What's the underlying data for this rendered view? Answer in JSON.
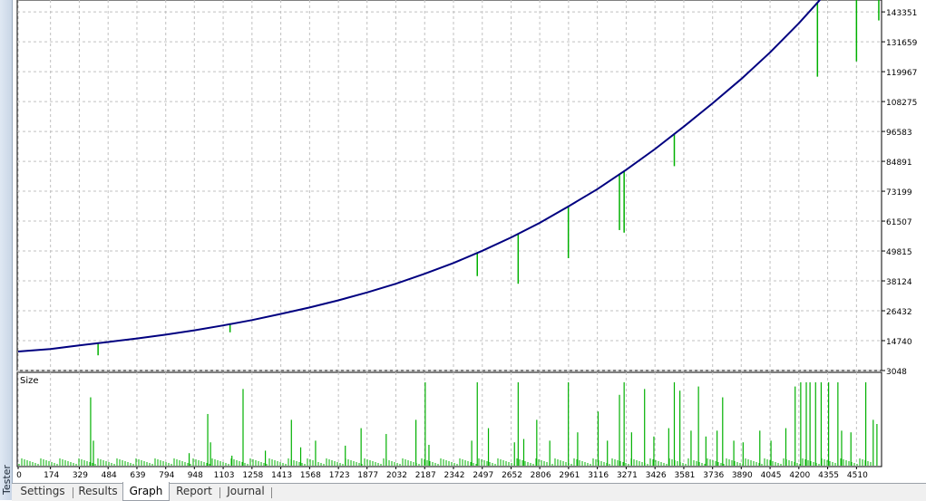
{
  "panel": {
    "title": "Tester"
  },
  "tabs": [
    {
      "label": "Settings",
      "active": false
    },
    {
      "label": "Results",
      "active": false
    },
    {
      "label": "Graph",
      "active": true
    },
    {
      "label": "Report",
      "active": false
    },
    {
      "label": "Journal",
      "active": false
    }
  ],
  "colors": {
    "balance": "#000080",
    "equity": "#00b000",
    "size_bars": "#00b000",
    "grid": "#c0c0c0",
    "background": "#ffffff"
  },
  "chart_data": [
    {
      "type": "line",
      "y_ticks": [
        "3048",
        "14740",
        "26432",
        "38124",
        "49815",
        "61507",
        "73199",
        "84891",
        "96583",
        "108275",
        "119967",
        "131659",
        "143351"
      ],
      "ylim": [
        3048,
        148000
      ],
      "xlim": [
        0,
        4640
      ],
      "series": [
        {
          "role": "balance",
          "x": [
            0,
            174,
            329,
            484,
            639,
            794,
            948,
            1103,
            1258,
            1413,
            1568,
            1723,
            1877,
            2032,
            2187,
            2342,
            2497,
            2652,
            2806,
            2961,
            3116,
            3271,
            3426,
            3581,
            3736,
            3890,
            4045,
            4200,
            4355,
            4510,
            4630
          ],
          "values": [
            10500,
            11500,
            12900,
            14200,
            15600,
            17100,
            18800,
            20700,
            22800,
            25200,
            27700,
            30500,
            33600,
            37000,
            40900,
            45100,
            49900,
            55100,
            60800,
            67300,
            74000,
            81600,
            89700,
            98500,
            107600,
            117100,
            127500,
            138900,
            151400,
            165000,
            177000
          ]
        },
        {
          "role": "equity_drawdowns",
          "x": [
            430,
            1035,
            1140,
            2470,
            2690,
            2960,
            3235,
            3260,
            3530,
            4300,
            4510,
            4630
          ],
          "values": [
            9000,
            20000,
            18000,
            40000,
            37000,
            47000,
            58000,
            57000,
            83000,
            118000,
            124000,
            140000
          ]
        }
      ]
    },
    {
      "type": "bar",
      "title": "Size",
      "x_ticks": [
        "0",
        "174",
        "329",
        "484",
        "639",
        "794",
        "948",
        "1103",
        "1258",
        "1413",
        "1568",
        "1723",
        "1877",
        "2032",
        "2187",
        "2342",
        "2497",
        "2652",
        "2806",
        "2961",
        "3116",
        "3271",
        "3426",
        "3581",
        "3736",
        "3890",
        "4045",
        "4200",
        "4355",
        "4510"
      ],
      "xlim": [
        0,
        4640
      ],
      "bars": [
        {
          "x": 390,
          "v": 0.82
        },
        {
          "x": 405,
          "v": 0.3
        },
        {
          "x": 920,
          "v": 0.15
        },
        {
          "x": 1020,
          "v": 0.62
        },
        {
          "x": 1035,
          "v": 0.28
        },
        {
          "x": 1150,
          "v": 0.12
        },
        {
          "x": 1210,
          "v": 0.92
        },
        {
          "x": 1330,
          "v": 0.18
        },
        {
          "x": 1470,
          "v": 0.55
        },
        {
          "x": 1520,
          "v": 0.22
        },
        {
          "x": 1600,
          "v": 0.3
        },
        {
          "x": 1760,
          "v": 0.24
        },
        {
          "x": 1845,
          "v": 0.45
        },
        {
          "x": 1980,
          "v": 0.38
        },
        {
          "x": 2140,
          "v": 0.55
        },
        {
          "x": 2190,
          "v": 1.0
        },
        {
          "x": 2210,
          "v": 0.25
        },
        {
          "x": 2440,
          "v": 0.3
        },
        {
          "x": 2470,
          "v": 1.0
        },
        {
          "x": 2530,
          "v": 0.45
        },
        {
          "x": 2670,
          "v": 0.28
        },
        {
          "x": 2690,
          "v": 1.0
        },
        {
          "x": 2720,
          "v": 0.32
        },
        {
          "x": 2790,
          "v": 0.55
        },
        {
          "x": 2860,
          "v": 0.3
        },
        {
          "x": 2960,
          "v": 1.0
        },
        {
          "x": 3010,
          "v": 0.4
        },
        {
          "x": 3120,
          "v": 0.65
        },
        {
          "x": 3170,
          "v": 0.3
        },
        {
          "x": 3235,
          "v": 0.85
        },
        {
          "x": 3260,
          "v": 1.0
        },
        {
          "x": 3300,
          "v": 0.4
        },
        {
          "x": 3370,
          "v": 0.92
        },
        {
          "x": 3420,
          "v": 0.35
        },
        {
          "x": 3500,
          "v": 0.45
        },
        {
          "x": 3530,
          "v": 1.0
        },
        {
          "x": 3560,
          "v": 0.9
        },
        {
          "x": 3620,
          "v": 0.42
        },
        {
          "x": 3660,
          "v": 0.95
        },
        {
          "x": 3700,
          "v": 0.35
        },
        {
          "x": 3760,
          "v": 0.42
        },
        {
          "x": 3790,
          "v": 0.82
        },
        {
          "x": 3850,
          "v": 0.3
        },
        {
          "x": 3900,
          "v": 0.28
        },
        {
          "x": 3990,
          "v": 0.42
        },
        {
          "x": 4050,
          "v": 0.3
        },
        {
          "x": 4130,
          "v": 0.45
        },
        {
          "x": 4180,
          "v": 0.95
        },
        {
          "x": 4210,
          "v": 1.0
        },
        {
          "x": 4240,
          "v": 1.0
        },
        {
          "x": 4260,
          "v": 1.0
        },
        {
          "x": 4290,
          "v": 1.0
        },
        {
          "x": 4320,
          "v": 1.0
        },
        {
          "x": 4360,
          "v": 1.0
        },
        {
          "x": 4410,
          "v": 1.0
        },
        {
          "x": 4430,
          "v": 0.42
        },
        {
          "x": 4480,
          "v": 0.4
        },
        {
          "x": 4560,
          "v": 1.0
        },
        {
          "x": 4600,
          "v": 0.55
        },
        {
          "x": 4620,
          "v": 0.5
        }
      ]
    }
  ]
}
